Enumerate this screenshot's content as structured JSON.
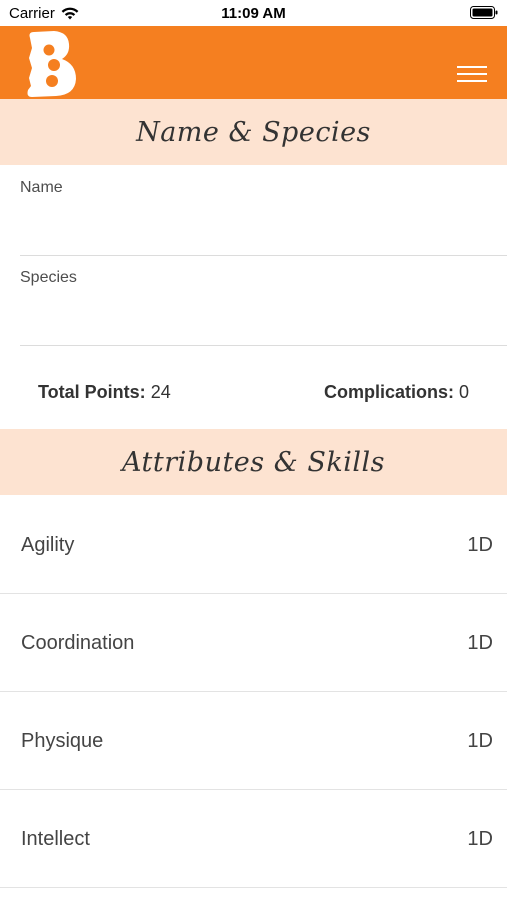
{
  "status_bar": {
    "carrier": "Carrier",
    "time": "11:09 AM",
    "wifi_icon": "wifi-icon",
    "battery_icon": "battery-icon"
  },
  "nav_bar": {
    "logo_icon": "b-logo-icon",
    "menu_icon": "hamburger-menu-icon",
    "background_color": "#f57f20"
  },
  "sections": {
    "name_species": {
      "title": "Name & Species"
    },
    "attributes_skills": {
      "title": "Attributes & Skills"
    },
    "header_color": "#fde3d1"
  },
  "form": {
    "name": {
      "label": "Name",
      "value": ""
    },
    "species": {
      "label": "Species",
      "value": ""
    }
  },
  "points": {
    "total_label": "Total Points:",
    "total_value": "24",
    "complications_label": "Complications:",
    "complications_value": "0"
  },
  "attributes": [
    {
      "name": "Agility",
      "value": "1D"
    },
    {
      "name": "Coordination",
      "value": "1D"
    },
    {
      "name": "Physique",
      "value": "1D"
    },
    {
      "name": "Intellect",
      "value": "1D"
    }
  ]
}
